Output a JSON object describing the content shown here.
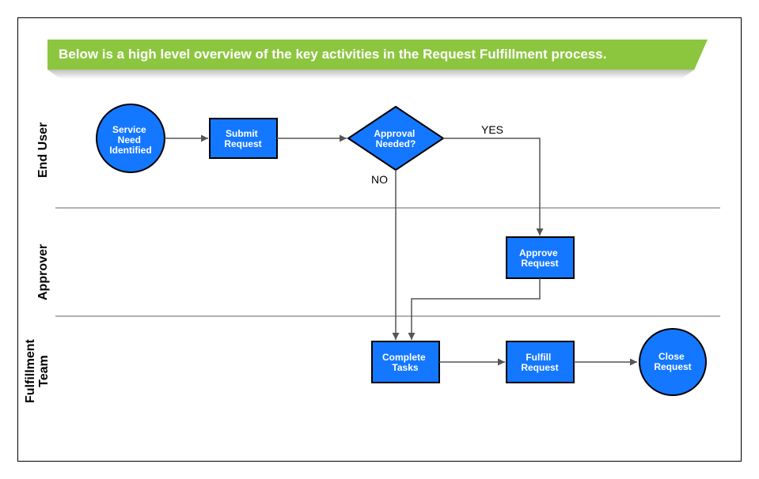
{
  "banner": {
    "text": "Below is a high level overview of the key activities in the Request Fulfillment process."
  },
  "swimlanes": {
    "end_user": "End User",
    "approver": "Approver",
    "fulfillment": "Fulfillment\nTeam"
  },
  "nodes": {
    "service_need": "Service\nNeed\nIdentified",
    "submit_request": "Submit\nRequest",
    "approval_needed": "Approval\nNeeded?",
    "approve_request": "Approve\nRequest",
    "complete_tasks": "Complete\nTasks",
    "fulfill_request": "Fulfill\nRequest",
    "close_request": "Close\nRequest"
  },
  "edges": {
    "yes": "YES",
    "no": "NO"
  }
}
